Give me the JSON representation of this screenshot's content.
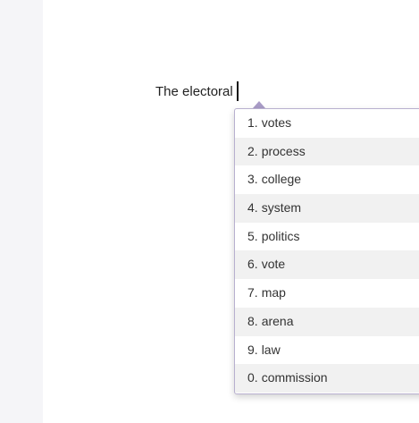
{
  "editor": {
    "text": "The electoral"
  },
  "suggestions": [
    {
      "num": "1.",
      "word": "votes"
    },
    {
      "num": "2.",
      "word": "process"
    },
    {
      "num": "3.",
      "word": "college"
    },
    {
      "num": "4.",
      "word": "system"
    },
    {
      "num": "5.",
      "word": "politics"
    },
    {
      "num": "6.",
      "word": "vote"
    },
    {
      "num": "7.",
      "word": "map"
    },
    {
      "num": "8.",
      "word": "arena"
    },
    {
      "num": "9.",
      "word": "law"
    },
    {
      "num": "0.",
      "word": "commission"
    }
  ],
  "colors": {
    "gutter": "#f5f5f8",
    "pointer": "#a99cc7",
    "alt_row": "#f1f1f1"
  }
}
